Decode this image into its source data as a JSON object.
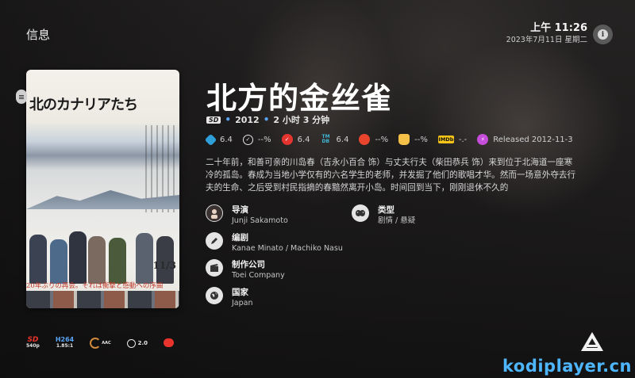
{
  "header": {
    "title": "信息"
  },
  "clock": {
    "time": "上午 11:26",
    "date": "2023年7月11日 星期二"
  },
  "info_button": {
    "icon": "info-icon"
  },
  "poster": {
    "title_text": "北のカナリアたち",
    "release_date": "11/3",
    "tagline": "20年ぶりの再会。それは衝撃と感動への序曲"
  },
  "movie": {
    "title": "北方的金丝雀",
    "quality_badge": "SD",
    "year": "2012",
    "runtime": "2 小时 3 分钟",
    "separator": "•"
  },
  "ratings": [
    {
      "icon": "kodi-icon",
      "value": "6.4",
      "color": "#2e9fd8"
    },
    {
      "icon": "trakt-icon",
      "value": "--%",
      "color": "#e6e6e6"
    },
    {
      "icon": "trakt-red-icon",
      "value": "6.4",
      "color": "#e3342f"
    },
    {
      "icon": "tmdb-icon",
      "value": "6.4",
      "color": "#3fb6d5"
    },
    {
      "icon": "tomato-icon",
      "value": "--%",
      "color": "#e8452c"
    },
    {
      "icon": "popcorn-icon",
      "value": "--%",
      "color": "#f5c048"
    },
    {
      "icon": "imdb-icon",
      "value": "-.-",
      "color": "#f5c518"
    },
    {
      "icon": "released-icon",
      "value": "Released 2012-11-3",
      "color": "#c74ddb"
    }
  ],
  "description": "二十年前，和善可亲的川岛春（吉永小百合 饰）与丈夫行夫（柴田恭兵 饰）来到位于北海道一座寒冷的孤岛。春成为当地小学仅有的六名学生的老师，并发掘了他们的歌唱才华。然而一场意外夺去行夫的生命、之后受到村民指摘的春黯然离开小岛。时间回到当下，刚刚退休不久的",
  "credits": {
    "director": {
      "label": "导演",
      "value": "Junji Sakamoto"
    },
    "genre": {
      "label": "类型",
      "value": "剧情 / 悬疑"
    },
    "writer": {
      "label": "编剧",
      "value": "Kanae Minato / Machiko Nasu"
    },
    "studio": {
      "label": "制作公司",
      "value": "Toei Company"
    },
    "country": {
      "label": "国家",
      "value": "Japan"
    }
  },
  "flags": {
    "video_res": {
      "top": "SD",
      "bottom": "540p"
    },
    "codec": {
      "top": "H264",
      "bottom": "1.85:1"
    },
    "audio": {
      "label": "AAC"
    },
    "channels": {
      "label": "2.0"
    }
  },
  "watermark": {
    "site": "kodiplayer.cn"
  },
  "colors": {
    "accent": "#4db6ff",
    "dot": "#5aa4f5"
  }
}
